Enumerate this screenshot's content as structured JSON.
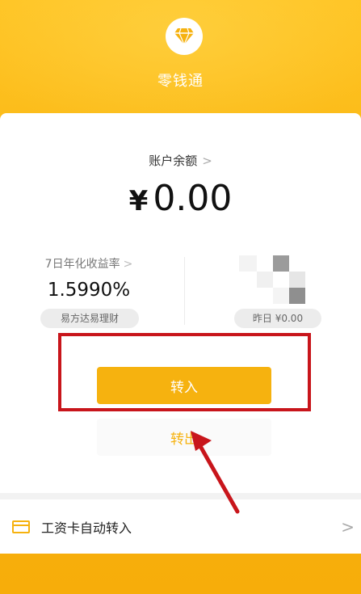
{
  "header": {
    "app_title": "零钱通",
    "logo_icon": "diamond-icon"
  },
  "balance": {
    "label": "账户余额",
    "chevron": ">",
    "currency": "¥",
    "amount": "0.00"
  },
  "yield": {
    "label": "7日年化收益率",
    "chevron": ">",
    "value": "1.5990%",
    "fund_name": "易方达易理财"
  },
  "yesterday": {
    "label": "昨日 ¥0.00"
  },
  "actions": {
    "transfer_in": "转入",
    "transfer_out": "转出"
  },
  "salary": {
    "label": "工资卡自动转入",
    "icon": "card-icon",
    "chevron": ">"
  },
  "colors": {
    "brand": "#f6b20f",
    "annotation": "#c8151b"
  }
}
